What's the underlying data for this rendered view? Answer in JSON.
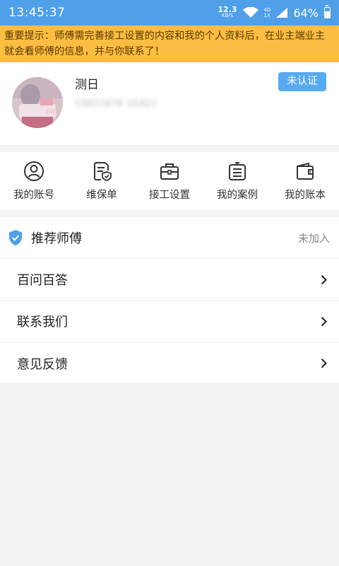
{
  "status_bar": {
    "time": "13:45:37",
    "net_speed": "12.3",
    "net_unit": "KB/S",
    "signal_top": "4G",
    "signal_bottom": "1X",
    "battery": "64%"
  },
  "notice": {
    "text": "重要提示：师傅需完善接工设置的内容和我的个人资料后，在业主端业主就会看师傅的信息，并与你联系了！"
  },
  "profile": {
    "name": "测日",
    "phone": "15821676 25421",
    "verify_label": "未认证"
  },
  "menu": {
    "items": [
      {
        "label": "我的账号",
        "icon": "user-icon"
      },
      {
        "label": "维保单",
        "icon": "document-shield-icon"
      },
      {
        "label": "接工设置",
        "icon": "toolbox-icon"
      },
      {
        "label": "我的案例",
        "icon": "clipboard-list-icon"
      },
      {
        "label": "我的账本",
        "icon": "wallet-icon"
      }
    ]
  },
  "list": {
    "recommend": {
      "label": "推荐师傅",
      "status": "未加入",
      "icon": "shield-check-icon"
    },
    "items": [
      {
        "label": "百问百答"
      },
      {
        "label": "联系我们"
      },
      {
        "label": "意见反馈"
      }
    ]
  },
  "colors": {
    "primary": "#4f9fe9",
    "notice_bg": "#fbbd42",
    "verify_bg": "#56aaf0",
    "page_bg": "#f3f3f3"
  }
}
